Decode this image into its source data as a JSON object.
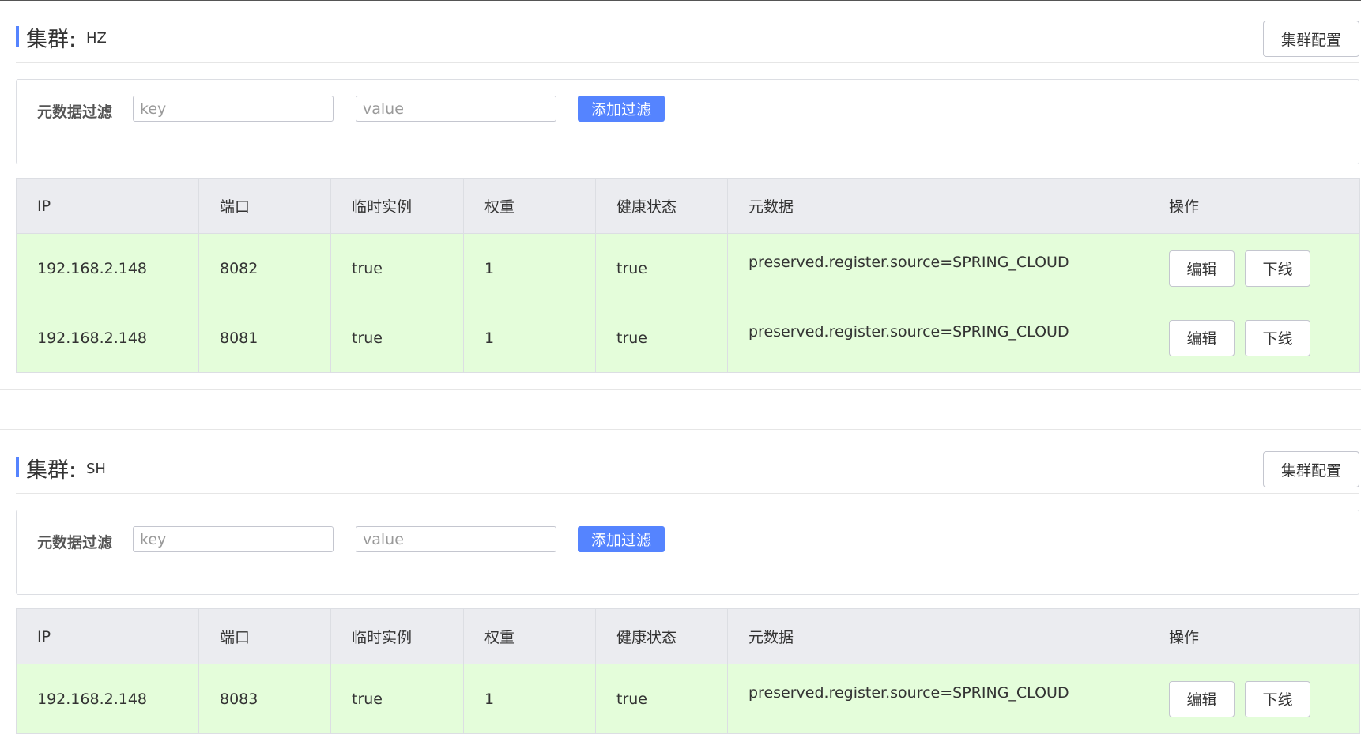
{
  "accent_color": "#5584ff",
  "row_bg_color": "#e4fdda",
  "header_bg_color": "#ebecf0",
  "clusters": [
    {
      "title": "集群:",
      "name": "HZ",
      "config_label": "集群配置",
      "filter": {
        "label": "元数据过滤",
        "key_placeholder": "key",
        "value_placeholder": "value",
        "add_label": "添加过滤"
      },
      "columns": [
        "IP",
        "端口",
        "临时实例",
        "权重",
        "健康状态",
        "元数据",
        "操作"
      ],
      "rows": [
        {
          "ip": "192.168.2.148",
          "port": "8082",
          "ephemeral": "true",
          "weight": "1",
          "healthy": "true",
          "metadata": "preserved.register.source=SPRING_CLOUD",
          "edit_label": "编辑",
          "offline_label": "下线"
        },
        {
          "ip": "192.168.2.148",
          "port": "8081",
          "ephemeral": "true",
          "weight": "1",
          "healthy": "true",
          "metadata": "preserved.register.source=SPRING_CLOUD",
          "edit_label": "编辑",
          "offline_label": "下线"
        }
      ]
    },
    {
      "title": "集群:",
      "name": "SH",
      "config_label": "集群配置",
      "filter": {
        "label": "元数据过滤",
        "key_placeholder": "key",
        "value_placeholder": "value",
        "add_label": "添加过滤"
      },
      "columns": [
        "IP",
        "端口",
        "临时实例",
        "权重",
        "健康状态",
        "元数据",
        "操作"
      ],
      "rows": [
        {
          "ip": "192.168.2.148",
          "port": "8083",
          "ephemeral": "true",
          "weight": "1",
          "healthy": "true",
          "metadata": "preserved.register.source=SPRING_CLOUD",
          "edit_label": "编辑",
          "offline_label": "下线"
        }
      ]
    }
  ]
}
